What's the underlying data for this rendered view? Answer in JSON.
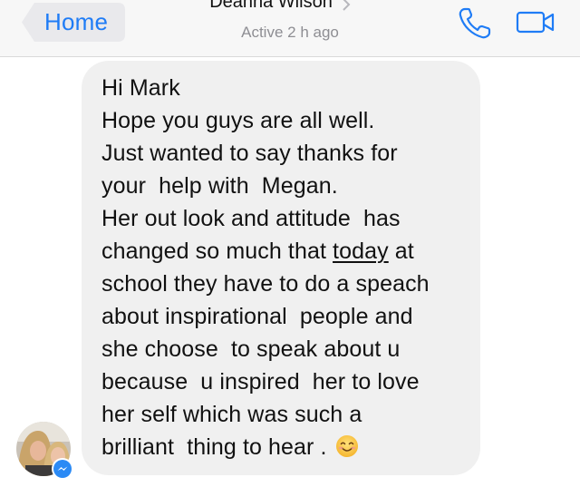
{
  "header": {
    "back_label": "Home",
    "contact_name": "Deanna Wilson",
    "status": "Active 2 h ago"
  },
  "message": {
    "lines": {
      "l1": "Hi Mark",
      "l2": "Hope you guys are all well.",
      "l3": "Just wanted to say thanks for",
      "l4": "your  help with  Megan.",
      "l5": "Her out look and attitude  has",
      "l6a": "changed so much that ",
      "l6b": "today",
      "l6c": " at",
      "l7": "school they have to do a speach",
      "l8": "about inspirational  people and",
      "l9": "she choose  to speak about u",
      "l10": "because  u inspired  her to love",
      "l11": "her self which was such a",
      "l12": "brilliant  thing to hear . "
    }
  },
  "colors": {
    "accent": "#1f7cf6",
    "bubble": "#f0f0f0",
    "header_bg": "#f7f7f7",
    "status_text": "#8e8e93"
  },
  "icons": {
    "back": "back-arrow-icon",
    "chevron": "chevron-right-icon",
    "call": "phone-icon",
    "video": "video-camera-icon",
    "emoji": "smiling-face-emoji",
    "badge": "messenger-icon"
  }
}
